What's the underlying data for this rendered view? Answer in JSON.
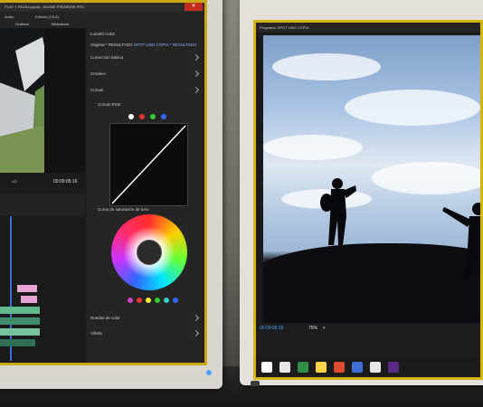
{
  "left_screen": {
    "window_title": "PLAY Y PAUSA.prproj - ADOBE PREMIERE PRO",
    "menu_tabs": [
      "Audio",
      "Edición (CS.6)",
      "Gráficos",
      "Bibliotecas"
    ],
    "source_timecode": "00:00:05:16",
    "lumetri": {
      "panel_title": "Lumetri Color",
      "clip_label": "Original * RESULTADO",
      "sequence_label": "SPOT UNO COPIA * RESULTADO",
      "sections": [
        "Corrección básica",
        "Creativo",
        "Curvas",
        "Curvas RGB",
        "Curva de saturación de tono",
        "Ruedas de color",
        "Viñeta"
      ]
    }
  },
  "right_screen": {
    "window_title": "Programa: SPOT UNO COPIA",
    "timecode": "00:00:05:16",
    "zoom": "75%",
    "colors": {
      "timecode": "#4aa3ff",
      "bezel_glow": "#d4b513"
    }
  },
  "icons": [
    "play-icon",
    "folder-icon",
    "word-icon",
    "premiere-icon",
    "store-icon"
  ]
}
